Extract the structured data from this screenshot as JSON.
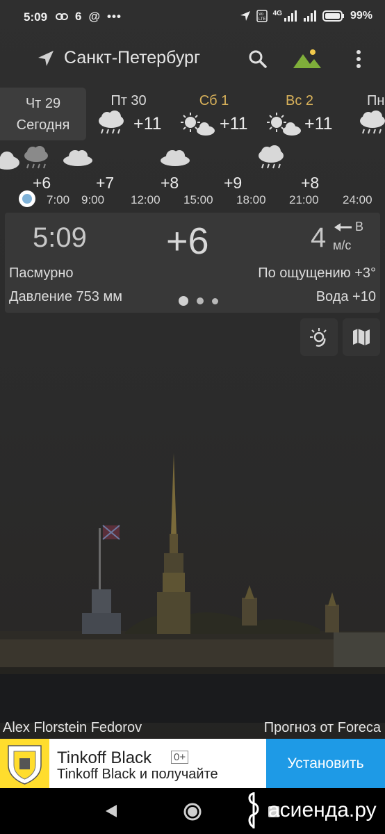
{
  "status_bar": {
    "time": "5:09",
    "temp_badge": "6",
    "dots": "•••",
    "network": "4G",
    "battery_pct": "99%"
  },
  "top_bar": {
    "city": "Санкт-Петербург"
  },
  "days": [
    {
      "name": "Чт 29",
      "sub": "Сегодня",
      "selected": true
    },
    {
      "name": "Пт 30",
      "temp": "+11",
      "icon": "rain-cloud-icon"
    },
    {
      "name": "Сб 1",
      "temp": "+11",
      "icon": "sun-cloud-icon",
      "weekend": true
    },
    {
      "name": "Вс 2",
      "temp": "+11",
      "icon": "sun-cloud-icon",
      "weekend": true
    },
    {
      "name": "Пн",
      "icon": "rain-cloud-icon"
    }
  ],
  "hourly": {
    "temps": [
      "+6",
      "+7",
      "+8",
      "+9",
      "+8"
    ],
    "times": [
      "7:00",
      "9:00",
      "12:00",
      "15:00",
      "18:00",
      "21:00",
      "24:00"
    ]
  },
  "current": {
    "time": "5:09",
    "temp": "+6",
    "wind_speed": "4",
    "wind_dir": "В",
    "wind_unit": "м/с",
    "condition": "Пасмурно",
    "feels_like": "По ощущению +3°",
    "pressure": "Давление 753 мм",
    "water": "Вода +10"
  },
  "credits": {
    "photo_author": "Alex Florstein Fedorov",
    "forecast_source": "Прогноз от Foreca"
  },
  "ad": {
    "title": "Tinkoff Black",
    "age": "0+",
    "subtitle": "Tinkoff Black и получайте",
    "cta": "Установить"
  },
  "watermark": "асиенда.ру",
  "colors": {
    "weekend": "#d8b15a",
    "ad_cta": "#1e9ae6",
    "ad_logo": "#ffdd2d",
    "now_dot": "#7fb2d8"
  }
}
